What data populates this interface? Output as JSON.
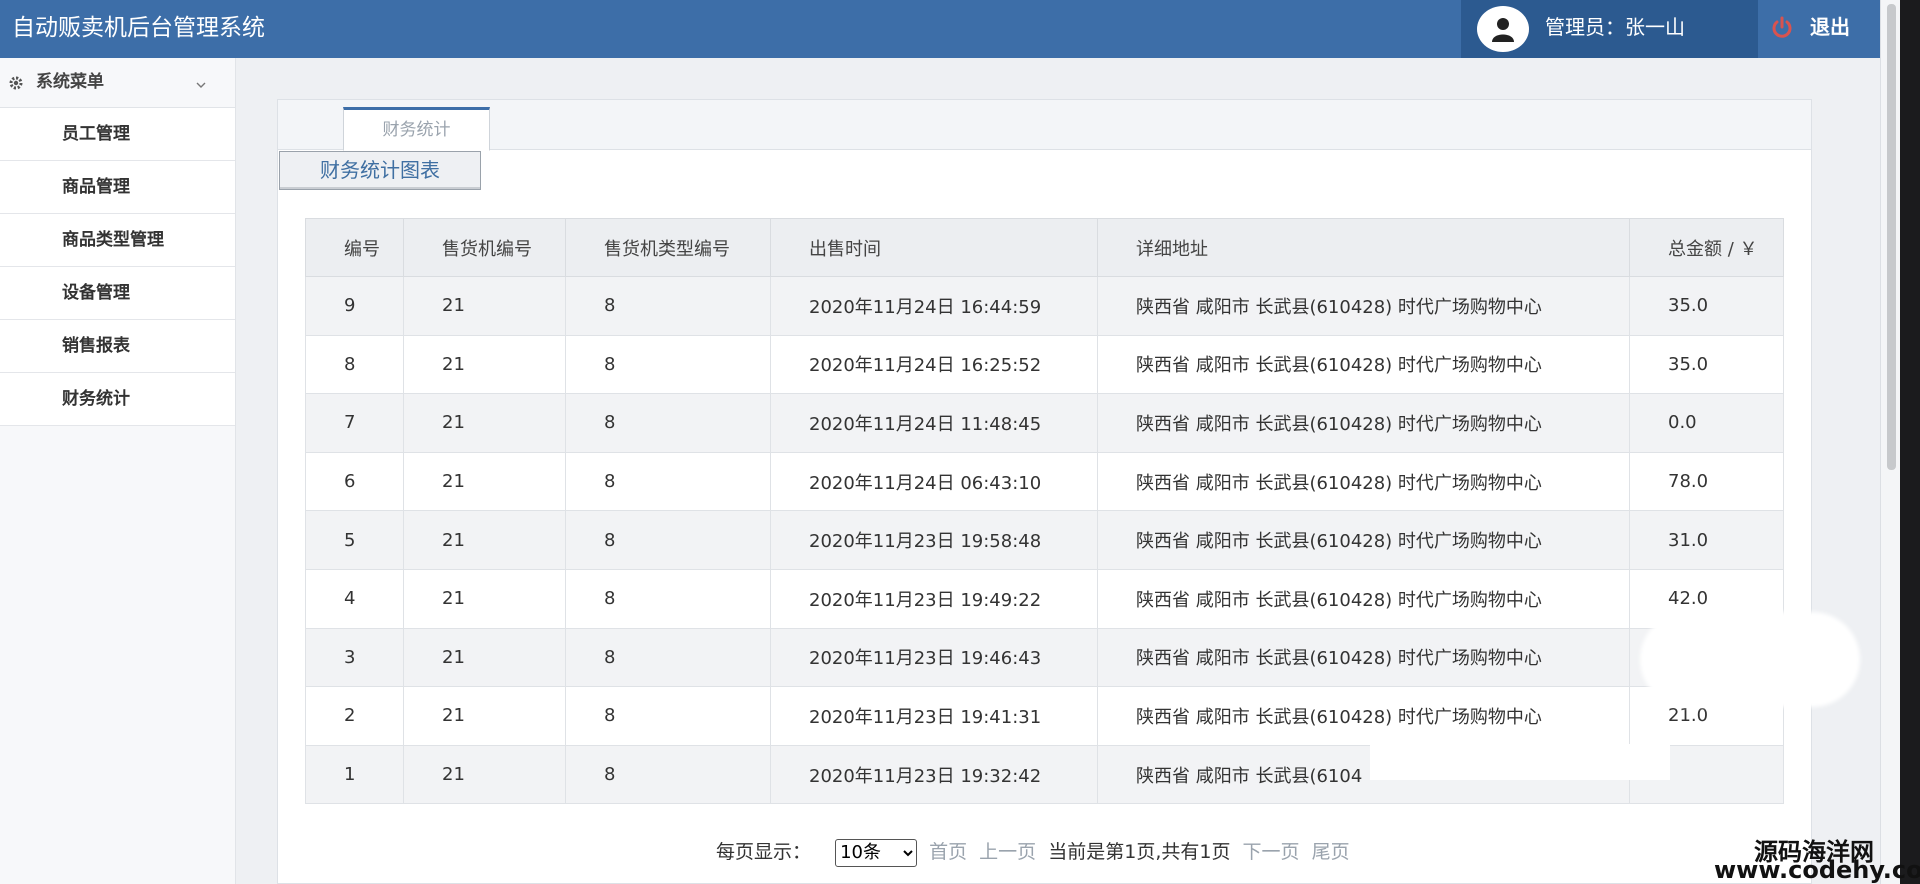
{
  "header": {
    "app_title": "自动贩卖机后台管理系统",
    "admin_label": "管理员：张一山",
    "logout_label": "退出"
  },
  "sidebar": {
    "menu_title": "系统菜单",
    "items": [
      {
        "label": "员工管理"
      },
      {
        "label": "商品管理"
      },
      {
        "label": "商品类型管理"
      },
      {
        "label": "设备管理"
      },
      {
        "label": "销售报表"
      },
      {
        "label": "财务统计"
      }
    ]
  },
  "main": {
    "tab_label": "财务统计",
    "chart_button_label": "财务统计图表",
    "table": {
      "columns": [
        "编号",
        "售货机编号",
        "售货机类型编号",
        "出售时间",
        "详细地址",
        "总金额 / ￥"
      ],
      "rows": [
        [
          "9",
          "21",
          "8",
          "2020年11月24日 16:44:59",
          "陕西省 咸阳市 长武县(610428) 时代广场购物中心",
          "35.0"
        ],
        [
          "8",
          "21",
          "8",
          "2020年11月24日 16:25:52",
          "陕西省 咸阳市 长武县(610428) 时代广场购物中心",
          "35.0"
        ],
        [
          "7",
          "21",
          "8",
          "2020年11月24日 11:48:45",
          "陕西省 咸阳市 长武县(610428) 时代广场购物中心",
          "0.0"
        ],
        [
          "6",
          "21",
          "8",
          "2020年11月24日 06:43:10",
          "陕西省 咸阳市 长武县(610428) 时代广场购物中心",
          "78.0"
        ],
        [
          "5",
          "21",
          "8",
          "2020年11月23日 19:58:48",
          "陕西省 咸阳市 长武县(610428) 时代广场购物中心",
          "31.0"
        ],
        [
          "4",
          "21",
          "8",
          "2020年11月23日 19:49:22",
          "陕西省 咸阳市 长武县(610428) 时代广场购物中心",
          "42.0"
        ],
        [
          "3",
          "21",
          "8",
          "2020年11月23日 19:46:43",
          "陕西省 咸阳市 长武县(610428) 时代广场购物中心",
          ""
        ],
        [
          "2",
          "21",
          "8",
          "2020年11月23日 19:41:31",
          "陕西省 咸阳市 长武县(610428) 时代广场购物中心",
          "21.0"
        ],
        [
          "1",
          "21",
          "8",
          "2020年11月23日 19:32:42",
          "陕西省 咸阳市 长武县(6104",
          ""
        ]
      ]
    }
  },
  "pagination": {
    "per_page_label": "每页显示：",
    "per_page_value": "10条",
    "first": "首页",
    "prev": "上一页",
    "info": "当前是第1页,共有1页",
    "next": "下一页",
    "last": "尾页"
  },
  "watermark": {
    "line1": "源码海洋网",
    "line2": "www.codehy.com"
  },
  "colors": {
    "header_bg": "#3d6ea8",
    "user_box_bg": "#2c5a90",
    "logout_icon": "#d9534f",
    "link_muted": "#9aa3ad"
  },
  "icons": [
    "user-icon",
    "power-icon",
    "gear-icon",
    "chevron-down-icon"
  ]
}
